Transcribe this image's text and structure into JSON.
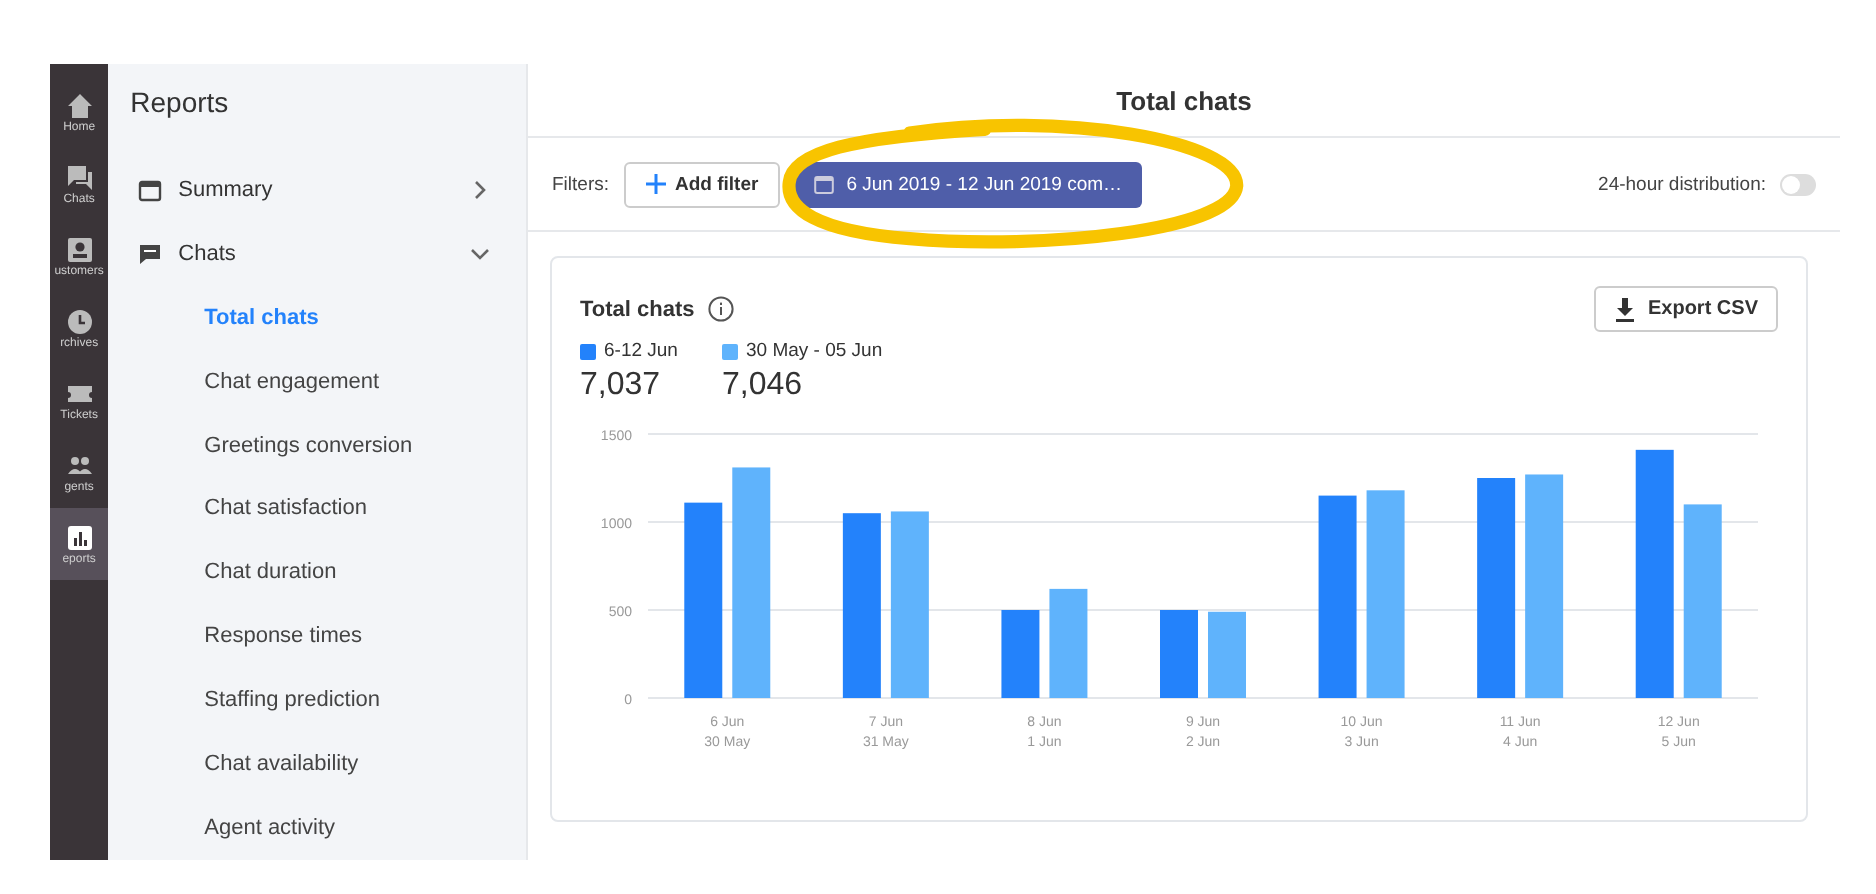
{
  "rail": [
    {
      "label": "Home",
      "selected": false
    },
    {
      "label": "Chats",
      "selected": false
    },
    {
      "label": "ustomers",
      "selected": false
    },
    {
      "label": "rchives",
      "selected": false
    },
    {
      "label": "Tickets",
      "selected": false
    },
    {
      "label": "gents",
      "selected": false
    },
    {
      "label": "eports",
      "selected": true
    }
  ],
  "sidebar": {
    "title": "Reports",
    "sections": [
      {
        "label": "Summary",
        "expanded": false
      },
      {
        "label": "Chats",
        "expanded": true,
        "children": [
          {
            "label": "Total chats",
            "selected": true
          },
          {
            "label": "Chat engagement",
            "selected": false
          },
          {
            "label": "Greetings conversion",
            "selected": false
          },
          {
            "label": "Chat satisfaction",
            "selected": false
          },
          {
            "label": "Chat duration",
            "selected": false
          },
          {
            "label": "Response times",
            "selected": false
          },
          {
            "label": "Staffing prediction",
            "selected": false
          },
          {
            "label": "Chat availability",
            "selected": false
          },
          {
            "label": "Agent activity",
            "selected": false
          }
        ]
      }
    ]
  },
  "page_title": "Total chats",
  "filters": {
    "label": "Filters:",
    "add_button": "Add filter",
    "date_range": "6 Jun 2019 - 12 Jun 2019 com…",
    "highlighted": true,
    "distribution": {
      "label": "24-hour distribution:",
      "on": false
    }
  },
  "card": {
    "title": "Total chats",
    "export_button": "Export CSV",
    "totals": [
      "7,037",
      "7,046"
    ],
    "chart_data": {
      "type": "bar",
      "categories": [
        "6 Jun\n30 May",
        "7 Jun\n31 May",
        "8 Jun\n1 Jun",
        "9 Jun\n2 Jun",
        "10 Jun\n3 Jun",
        "11 Jun\n4 Jun",
        "12 Jun\n5 Jun"
      ],
      "ylim": [
        0,
        1500
      ],
      "yticks": [
        0,
        500,
        1000,
        1500
      ],
      "series": [
        {
          "name": "6-12 Jun",
          "color": "#2382fb",
          "values": [
            1110,
            1050,
            500,
            500,
            1150,
            1250,
            1410
          ]
        },
        {
          "name": "30 May - 05 Jun",
          "color": "#5fb3fc",
          "values": [
            1310,
            1060,
            620,
            490,
            1180,
            1270,
            1100
          ]
        }
      ]
    }
  }
}
